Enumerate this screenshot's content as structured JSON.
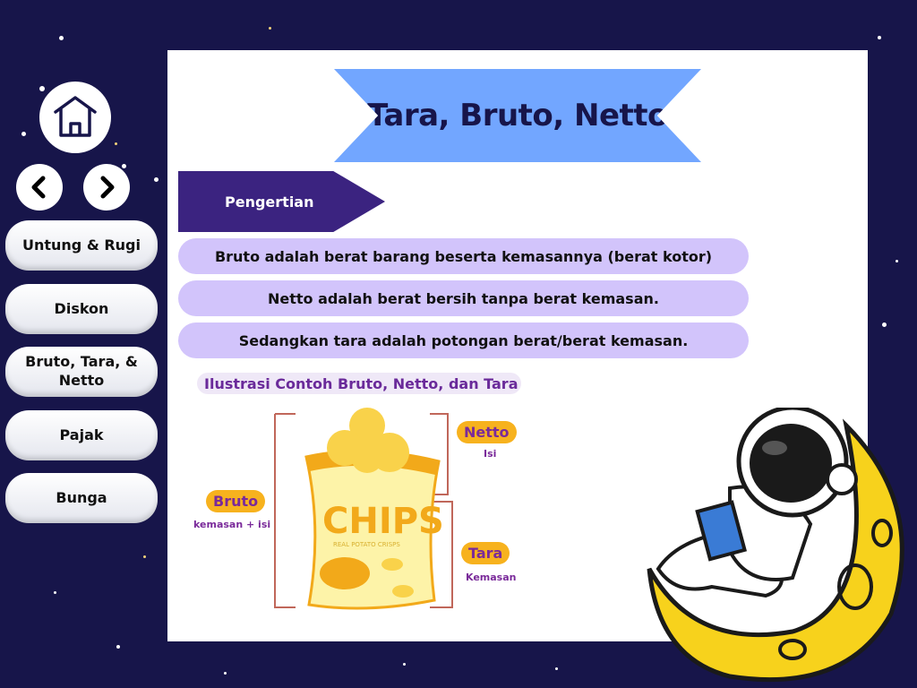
{
  "title": "Tara, Bruto, Netto",
  "section_label": "Pengertian",
  "definitions": [
    "Bruto adalah berat barang beserta kemasannya (berat kotor)",
    "Netto adalah berat bersih tanpa berat kemasan.",
    "Sedangkan tara adalah potongan berat/berat kemasan."
  ],
  "sidebar": {
    "items": [
      {
        "label": "Untung & Rugi"
      },
      {
        "label": "Diskon"
      },
      {
        "label": "Bruto, Tara, & Netto"
      },
      {
        "label": "Pajak"
      },
      {
        "label": "Bunga"
      }
    ]
  },
  "illustration": {
    "title": "Ilustrasi Contoh Bruto, Netto, dan Tara",
    "bag_text": "CHIPS",
    "bag_subtext": "REAL POTATO CRISPS",
    "bruto": "Bruto",
    "bruto_desc": "kemasan + isi",
    "netto": "Netto",
    "netto_desc": "Isi",
    "tara": "Tara",
    "tara_desc": "Kemasan"
  },
  "colors": {
    "background": "#17154a",
    "ribbon": "#72a6ff",
    "tag": "#3b2380",
    "definition": "#d2c4fb"
  }
}
